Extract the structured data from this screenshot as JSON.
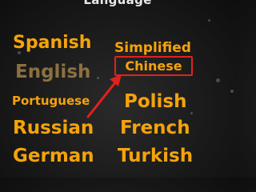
{
  "header": {
    "title": "Language"
  },
  "languages": {
    "spanish": "Spanish",
    "english": "English",
    "portuguese": "Portuguese",
    "russian": "Russian",
    "german": "German",
    "simplified": "Simplified",
    "chinese": "Chinese",
    "polish": "Polish",
    "french": "French",
    "turkish": "Turkish"
  },
  "colors": {
    "option_text": "#f5a30a",
    "selected_option_text": "#8b7140",
    "annotation": "#e0221f",
    "background": "#1a1a1a"
  },
  "annotations": {
    "highlight": "box around Chinese option",
    "pointer": "arrow pointing to Chinese option"
  }
}
